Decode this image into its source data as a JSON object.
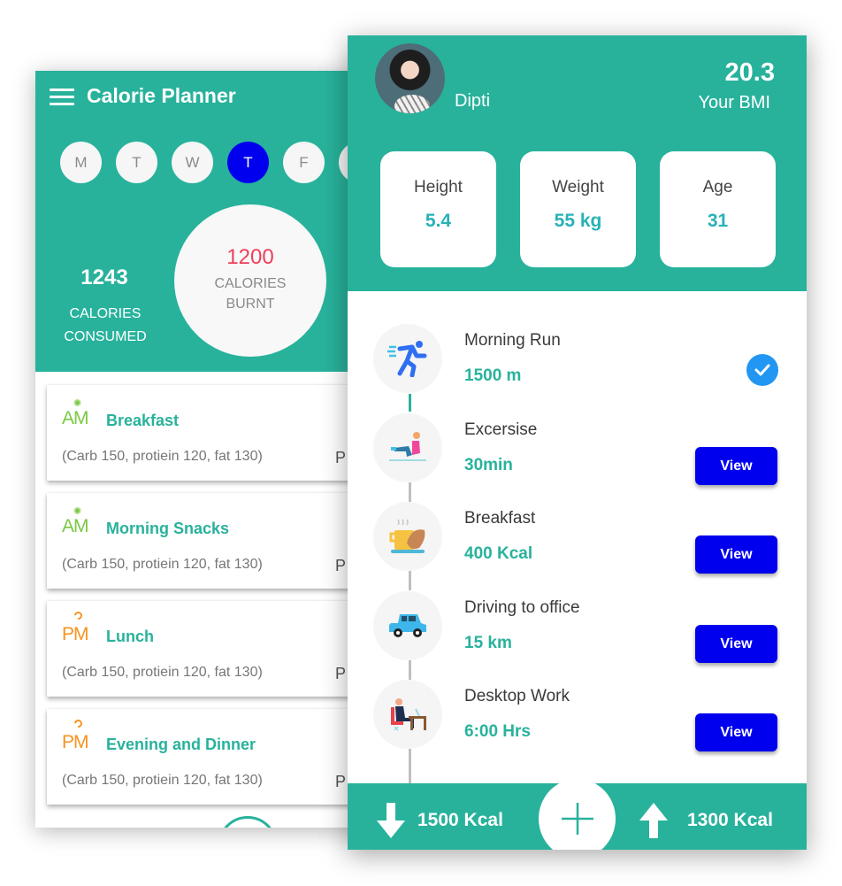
{
  "planner": {
    "title": "Calorie Planner",
    "menu_icon": "hamburger-menu-icon",
    "days": [
      {
        "label": "M",
        "active": false
      },
      {
        "label": "T",
        "active": false
      },
      {
        "label": "W",
        "active": false
      },
      {
        "label": "T",
        "active": true
      },
      {
        "label": "F",
        "active": false
      },
      {
        "label": "",
        "active": false
      }
    ],
    "consumed": {
      "value": "1243",
      "label": "CALORIES CONSUMED"
    },
    "burnt": {
      "value": "1200",
      "label": "CALORIES BURNT"
    },
    "meals": [
      {
        "tag": "AM",
        "name": "Breakfast",
        "macros": "(Carb 150, protiein 120, fat 130)",
        "trailing": "P"
      },
      {
        "tag": "AM",
        "name": "Morning Snacks",
        "macros": "(Carb 150, protiein 120, fat 130)",
        "trailing": "P"
      },
      {
        "tag": "PM",
        "name": "Lunch",
        "macros": "(Carb 150, protiein 120, fat 130)",
        "trailing": "P"
      },
      {
        "tag": "PM",
        "name": "Evening and Dinner",
        "macros": "(Carb 150, protiein 120, fat 130)",
        "trailing": "P"
      }
    ]
  },
  "profile": {
    "name": "Dipti",
    "bmi_value": "20.3",
    "bmi_label": "Your BMI",
    "stats": [
      {
        "label": "Height",
        "value": "5.4"
      },
      {
        "label": "Weight",
        "value": "55 kg"
      },
      {
        "label": "Age",
        "value": "31"
      }
    ],
    "activities": [
      {
        "icon": "running-icon",
        "title": "Morning Run",
        "value": "1500 m",
        "status": "done"
      },
      {
        "icon": "exercise-icon",
        "title": "Excersise",
        "value": "30min",
        "action": "View"
      },
      {
        "icon": "breakfast-icon",
        "title": "Breakfast",
        "value": "400 Kcal",
        "action": "View"
      },
      {
        "icon": "car-icon",
        "title": "Driving to office",
        "value": "15 km",
        "action": "View"
      },
      {
        "icon": "desk-work-icon",
        "title": "Desktop Work",
        "value": "6:00 Hrs",
        "action": "View"
      }
    ],
    "bottom_bar": {
      "intake": "1500 Kcal",
      "burn": "1300 Kcal"
    }
  },
  "colors": {
    "teal": "#28b29c",
    "active_day": "#0000ee",
    "burnt_value": "#ef3f5c",
    "view_button": "#0000ee",
    "check": "#2196f3",
    "am_tag": "#7ac943",
    "pm_tag": "#f7931e"
  }
}
